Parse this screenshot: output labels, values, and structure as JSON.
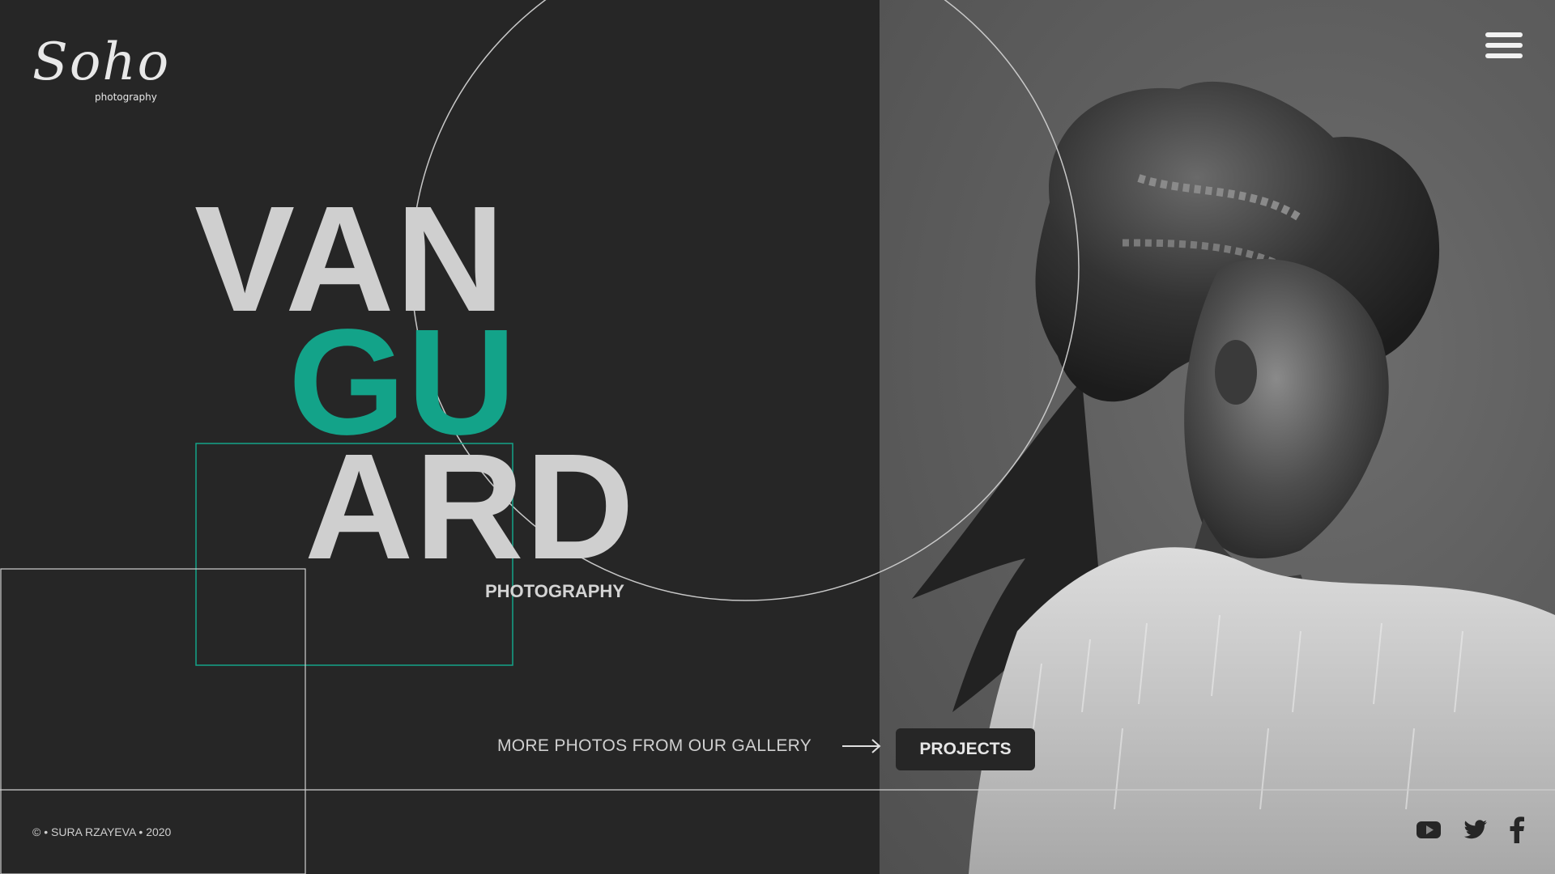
{
  "brand": {
    "logo_script": "Soho",
    "logo_sub": "photography"
  },
  "hero": {
    "title_line1": "VAN",
    "title_line2": "GU",
    "title_line3": "ARD",
    "subtitle": "PHOTOGRAPHY"
  },
  "actions": {
    "gallery_link": "MORE PHOTOS FROM OUR GALLERY",
    "projects_button": "PROJECTS"
  },
  "footer": {
    "copyright": "© • SURA RZAYEVA • 2020"
  },
  "icons": {
    "menu": "hamburger-icon",
    "arrow": "arrow-right-icon",
    "social": [
      "youtube-icon",
      "twitter-icon",
      "facebook-icon"
    ]
  },
  "colors": {
    "background": "#262626",
    "accent": "#13a389",
    "title_gray": "#cfcfcf",
    "photo_bg": "#606060",
    "line": "#bdbdbd"
  }
}
